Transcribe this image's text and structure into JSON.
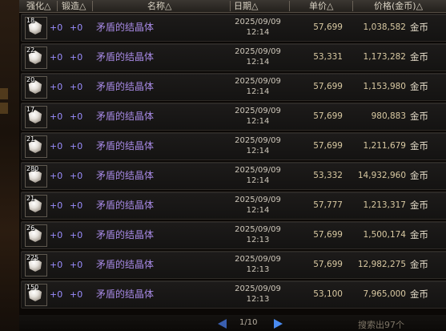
{
  "header": {
    "col_enhance": "强化△",
    "col_forge": "锻造△",
    "col_name": "名称△",
    "col_date": "日期△",
    "col_unit": "单价△",
    "col_price": "价格(金币)△"
  },
  "rows": [
    {
      "qty": "18",
      "enhance": "+0",
      "forge": "+0",
      "name": "矛盾的结晶体",
      "date": "2025/09/09",
      "time": "12:14",
      "unit": "57,699",
      "price": "1,038,582",
      "currency": "金币"
    },
    {
      "qty": "22",
      "enhance": "+0",
      "forge": "+0",
      "name": "矛盾的结晶体",
      "date": "2025/09/09",
      "time": "12:14",
      "unit": "53,331",
      "price": "1,173,282",
      "currency": "金币"
    },
    {
      "qty": "20",
      "enhance": "+0",
      "forge": "+0",
      "name": "矛盾的结晶体",
      "date": "2025/09/09",
      "time": "12:14",
      "unit": "57,699",
      "price": "1,153,980",
      "currency": "金币"
    },
    {
      "qty": "17",
      "enhance": "+0",
      "forge": "+0",
      "name": "矛盾的结晶体",
      "date": "2025/09/09",
      "time": "12:14",
      "unit": "57,699",
      "price": "980,883",
      "currency": "金币"
    },
    {
      "qty": "21",
      "enhance": "+0",
      "forge": "+0",
      "name": "矛盾的结晶体",
      "date": "2025/09/09",
      "time": "12:14",
      "unit": "57,699",
      "price": "1,211,679",
      "currency": "金币"
    },
    {
      "qty": "280",
      "enhance": "+0",
      "forge": "+0",
      "name": "矛盾的结晶体",
      "date": "2025/09/09",
      "time": "12:14",
      "unit": "53,332",
      "price": "14,932,960",
      "currency": "金币"
    },
    {
      "qty": "21",
      "enhance": "+0",
      "forge": "+0",
      "name": "矛盾的结晶体",
      "date": "2025/09/09",
      "time": "12:14",
      "unit": "57,777",
      "price": "1,213,317",
      "currency": "金币"
    },
    {
      "qty": "26",
      "enhance": "+0",
      "forge": "+0",
      "name": "矛盾的结晶体",
      "date": "2025/09/09",
      "time": "12:13",
      "unit": "57,699",
      "price": "1,500,174",
      "currency": "金币"
    },
    {
      "qty": "225",
      "enhance": "+0",
      "forge": "+0",
      "name": "矛盾的结晶体",
      "date": "2025/09/09",
      "time": "12:13",
      "unit": "57,699",
      "price": "12,982,275",
      "currency": "金币"
    },
    {
      "qty": "150",
      "enhance": "+0",
      "forge": "+0",
      "name": "矛盾的结晶体",
      "date": "2025/09/09",
      "time": "12:13",
      "unit": "53,100",
      "price": "7,965,000",
      "currency": "金币"
    }
  ],
  "footer": {
    "page": "1/10",
    "search_result": "搜索出97个"
  },
  "icons": {
    "item": "crystal-icon",
    "prev": "prev-page-arrow-icon",
    "next": "next-page-arrow-icon"
  }
}
